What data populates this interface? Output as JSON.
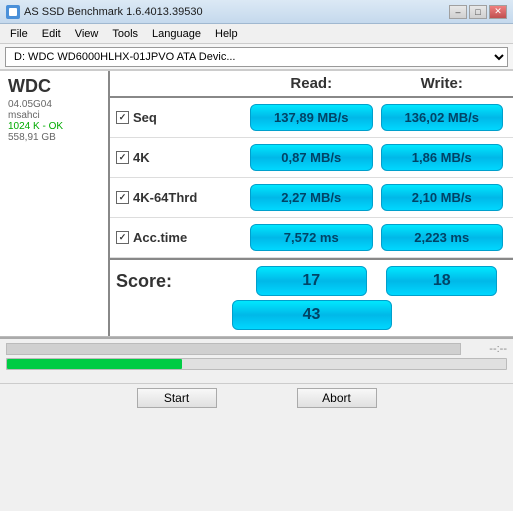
{
  "titleBar": {
    "title": "AS SSD Benchmark 1.6.4013.39530",
    "minBtn": "–",
    "maxBtn": "□",
    "closeBtn": "✕"
  },
  "menu": {
    "items": [
      "File",
      "Edit",
      "View",
      "Tools",
      "Language",
      "Help"
    ]
  },
  "drive": {
    "label": "D: WDC WD6000HLHX-01JPVO ATA Devic..."
  },
  "sidebar": {
    "brand": "WDC",
    "model": "04.05G04",
    "type": "msahci",
    "status": "1024 K - OK",
    "size": "558,91 GB"
  },
  "benchHeader": {
    "read": "Read:",
    "write": "Write:"
  },
  "rows": [
    {
      "id": "seq",
      "label": "Seq",
      "checked": true,
      "readVal": "137,89 MB/s",
      "writeVal": "136,02 MB/s"
    },
    {
      "id": "4k",
      "label": "4K",
      "checked": true,
      "readVal": "0,87 MB/s",
      "writeVal": "1,86 MB/s"
    },
    {
      "id": "4k64thrd",
      "label": "4K-64Thrd",
      "checked": true,
      "readVal": "2,27 MB/s",
      "writeVal": "2,10 MB/s"
    },
    {
      "id": "acctime",
      "label": "Acc.time",
      "checked": true,
      "readVal": "7,572 ms",
      "writeVal": "2,223 ms"
    }
  ],
  "score": {
    "label": "Score:",
    "readScore": "17",
    "writeScore": "18",
    "totalScore": "43"
  },
  "progress": {
    "topBarPercent": 0,
    "bottomBarPercent": 35,
    "timeLabel": "--:--"
  },
  "buttons": {
    "start": "Start",
    "abort": "Abort"
  }
}
